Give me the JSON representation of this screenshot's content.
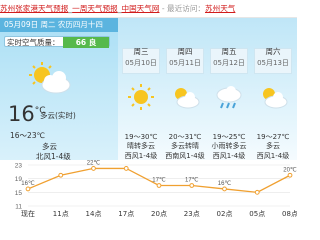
{
  "topbar": {
    "link1": "苏州张家港天气预报",
    "sep1": "_",
    "link2": "一周天气预报",
    "sep2": "_",
    "link3": "中国天气网",
    "source_prefix": " - 最近访问：",
    "source_link": "苏州天气"
  },
  "today": {
    "date_line": "05月09日 周二 农历四月十四",
    "aqi_label": "实时空气质量：",
    "aqi_value": "66 良",
    "temp": "16",
    "temp_unit": "°C",
    "desc": "多云(实时)",
    "range": "16～23℃",
    "cond": "多云",
    "wind": "北风1-4级",
    "icon": "partly-cloudy"
  },
  "forecast": [
    {
      "day": "周三",
      "date": "05月10日",
      "range": "19～30℃",
      "cond": "晴转多云",
      "wind": "西风1-4级",
      "icon": "sunny"
    },
    {
      "day": "周四",
      "date": "05月11日",
      "range": "20～31℃",
      "cond": "多云转晴",
      "wind": "西南风1-4级",
      "icon": "partly-cloudy"
    },
    {
      "day": "周五",
      "date": "05月12日",
      "range": "19～25℃",
      "cond": "小雨转多云",
      "wind": "西风1-4级",
      "icon": "light-rain"
    },
    {
      "day": "周六",
      "date": "05月13日",
      "range": "19～27℃",
      "cond": "多云",
      "wind": "西风1-4级",
      "icon": "partly-cloudy"
    }
  ],
  "colors": {
    "accent": "#5bb4df",
    "aqi_good": "#56b94c",
    "link": "#d11b1b",
    "line": "#f0a030"
  },
  "chart_data": {
    "type": "line",
    "categories": [
      "现在",
      "11点",
      "14点",
      "17点",
      "20点",
      "23点",
      "02点",
      "05点",
      "08点"
    ],
    "values": [
      16,
      20,
      22,
      22,
      17,
      17,
      16,
      15,
      20
    ],
    "labels": [
      "16℃",
      "",
      "22℃",
      "",
      "17℃",
      "17℃",
      "16℃",
      "",
      "20℃"
    ],
    "y_ticks": [
      23,
      19,
      15,
      11
    ],
    "ylim": [
      11,
      23
    ],
    "grid": true,
    "title": "",
    "xlabel": "",
    "ylabel": ""
  }
}
